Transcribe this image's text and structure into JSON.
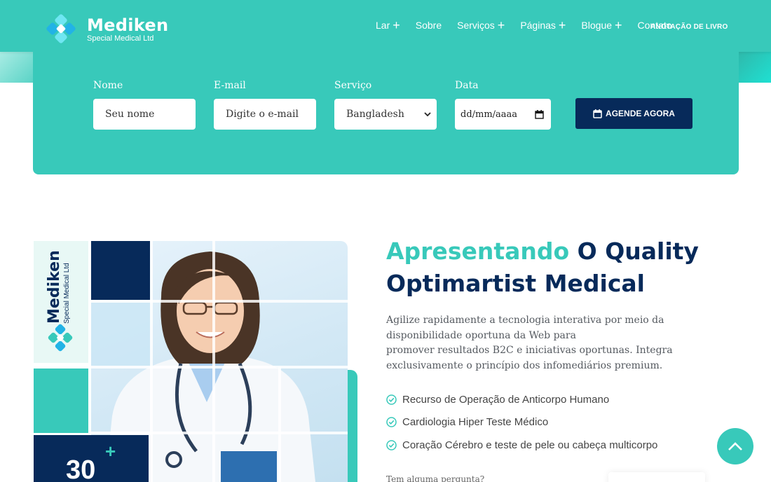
{
  "brand": {
    "name": "Mediken",
    "tagline": "Special Medical Ltd",
    "accent": "#38c9ba",
    "navy": "#072a5a"
  },
  "nav": {
    "items": [
      {
        "label": "Lar",
        "has_submenu": true
      },
      {
        "label": "Sobre",
        "has_submenu": false
      },
      {
        "label": "Serviços",
        "has_submenu": true
      },
      {
        "label": "Páginas",
        "has_submenu": true
      },
      {
        "label": "Blogue",
        "has_submenu": true
      },
      {
        "label": "Contato",
        "has_submenu": false
      }
    ],
    "cta": "ANOTAÇÃO DE LIVRO"
  },
  "appointment": {
    "name_label": "Nome",
    "name_placeholder": "Seu nome",
    "email_label": "E-mail",
    "email_placeholder": "Digite o e-mail",
    "service_label": "Serviço",
    "service_selected": "Bangladesh",
    "date_label": "Data",
    "date_placeholder": "dd/mm/aaaa",
    "submit": "AGENDE AGORA"
  },
  "about": {
    "title_highlight": "Apresentando",
    "title_rest": "O Quality Optimartist Medical",
    "description_line1": "Agilize rapidamente a tecnologia interativa por meio da disponibilidade oportuna da Web para",
    "description_line2": "promover resultados B2C e iniciativas oportunas. Integra exclusivamente o princípio dos infomediários premium.",
    "features": [
      "Recurso de Operação de Anticorpo Humano",
      "Cardiologia Hiper Teste Médico",
      "Coração Cérebro e teste de pele ou cabeça multicorpo"
    ],
    "question": "Tem alguma pergunta?",
    "stat_number": "30",
    "stat_plus": "+"
  },
  "icons": {
    "logo": "mediken-logo-icon",
    "submenu": "plus-icon",
    "calendar": "calendar-icon",
    "check": "check-circle-icon",
    "scroll_top": "chevron-up-icon"
  }
}
